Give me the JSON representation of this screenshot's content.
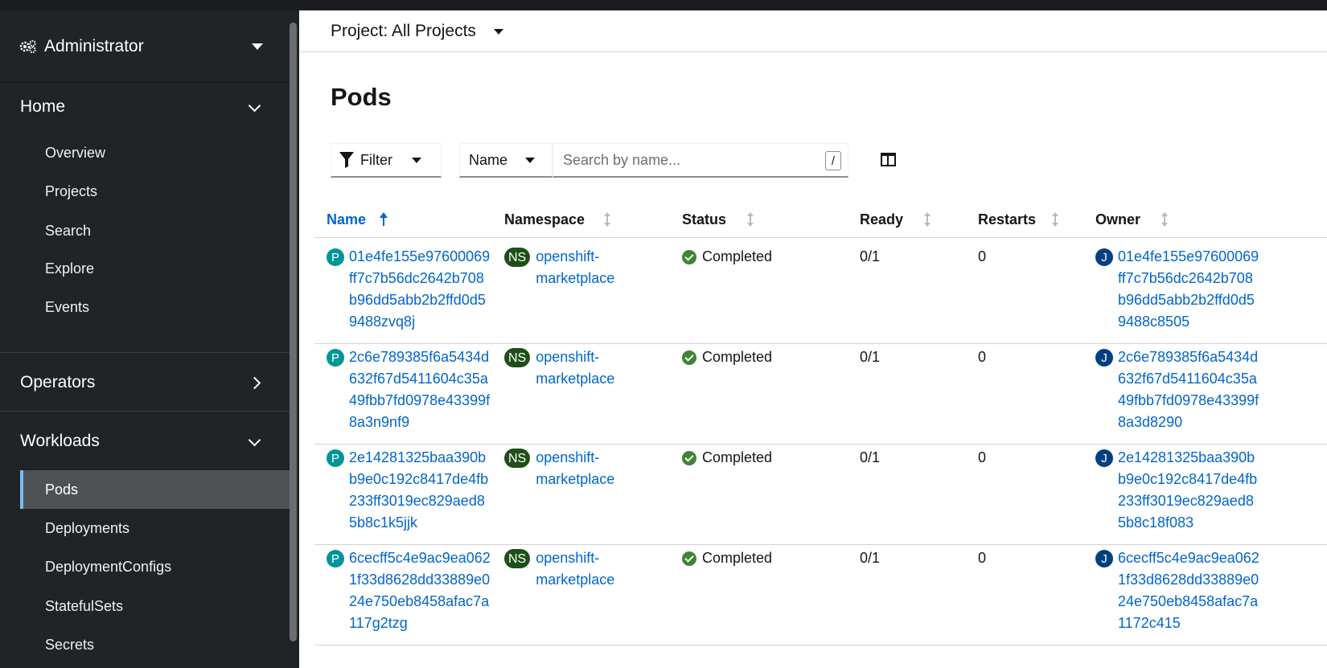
{
  "sidebar": {
    "perspective": "Administrator",
    "sections": [
      {
        "label": "Home",
        "items": [
          "Overview",
          "Projects",
          "Search",
          "Explore",
          "Events"
        ]
      },
      {
        "label": "Operators"
      },
      {
        "label": "Workloads",
        "items": [
          "Pods",
          "Deployments",
          "DeploymentConfigs",
          "StatefulSets",
          "Secrets"
        ]
      }
    ]
  },
  "header": {
    "project_selector": "Project: All Projects"
  },
  "page": {
    "title": "Pods"
  },
  "toolbar": {
    "filter_label": "Filter",
    "name_select": "Name",
    "search_placeholder": "Search by name...",
    "slash_hint": "/"
  },
  "table": {
    "columns": [
      "Name",
      "Namespace",
      "Status",
      "Ready",
      "Restarts",
      "Owner"
    ],
    "rows": [
      {
        "name_badge": "P",
        "name": "01e4fe155e97600069ff7c7b56dc2642b708b96dd5abb2b2ffd0d59488zvq8j",
        "ns_badge": "NS",
        "namespace": "openshift-marketplace",
        "status": "Completed",
        "ready": "0/1",
        "restarts": "0",
        "owner_badge": "J",
        "owner": "01e4fe155e97600069ff7c7b56dc2642b708b96dd5abb2b2ffd0d59488c8505"
      },
      {
        "name_badge": "P",
        "name": "2c6e789385f6a5434d632f67d5411604c35a49fbb7fd0978e43399f8a3n9nf9",
        "ns_badge": "NS",
        "namespace": "openshift-marketplace",
        "status": "Completed",
        "ready": "0/1",
        "restarts": "0",
        "owner_badge": "J",
        "owner": "2c6e789385f6a5434d632f67d5411604c35a49fbb7fd0978e43399f8a3d8290"
      },
      {
        "name_badge": "P",
        "name": "2e14281325baa390bb9e0c192c8417de4fb233ff3019ec829aed85b8c1k5jjk",
        "ns_badge": "NS",
        "namespace": "openshift-marketplace",
        "status": "Completed",
        "ready": "0/1",
        "restarts": "0",
        "owner_badge": "J",
        "owner": "2e14281325baa390bb9e0c192c8417de4fb233ff3019ec829aed85b8c18f083"
      },
      {
        "name_badge": "P",
        "name": "6cecff5c4e9ac9ea0621f33d8628dd33889e024e750eb8458afac7a117g2tzg",
        "ns_badge": "NS",
        "namespace": "openshift-marketplace",
        "status": "Completed",
        "ready": "0/1",
        "restarts": "0",
        "owner_badge": "J",
        "owner": "6cecff5c4e9ac9ea0621f33d8628dd33889e024e750eb8458afac7a1172c415"
      }
    ]
  },
  "colors": {
    "sidebar_bg": "#212427",
    "active_item_bg": "#4f5255",
    "active_indicator": "#73bcf7",
    "link": "#0066cc",
    "pod_badge": "#009596",
    "job_badge": "#004080",
    "namespace_badge": "#1e4f18",
    "success": "#3e8635"
  }
}
